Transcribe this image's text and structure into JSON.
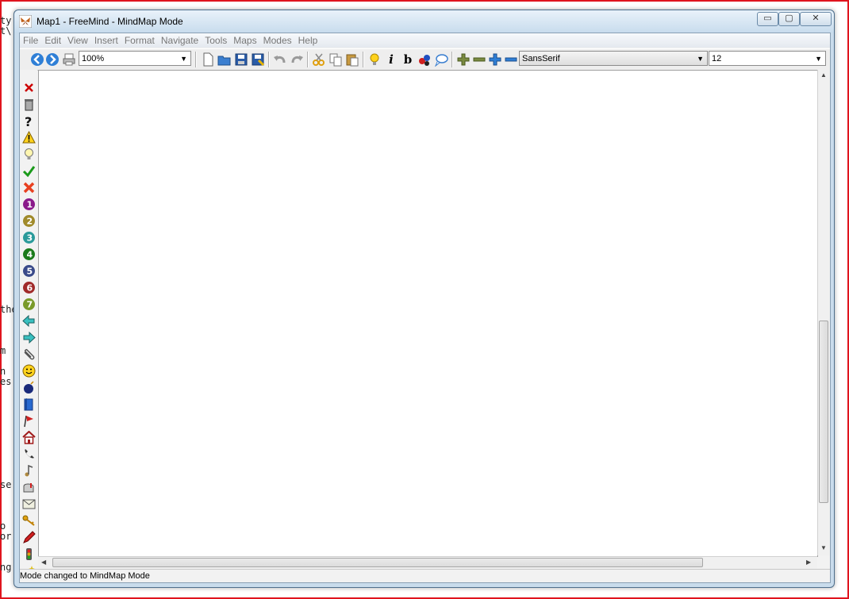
{
  "window": {
    "title": "Map1 - FreeMind - MindMap Mode",
    "minimize_label": "▭",
    "maximize_label": "▢",
    "close_label": "✕"
  },
  "menu": [
    "File",
    "Edit",
    "View",
    "Insert",
    "Format",
    "Navigate",
    "Tools",
    "Maps",
    "Modes",
    "Help"
  ],
  "toolbar": {
    "zoom_value": "100%",
    "font_family": "SansSerif",
    "font_size": "12",
    "bold_label": "b",
    "italic_label": "i"
  },
  "icons_sidebar": [
    "remove-icon",
    "trash-icon",
    "question-icon",
    "warning-icon",
    "idea-icon",
    "check-icon",
    "cross-icon",
    "priority-1-icon",
    "priority-2-icon",
    "priority-3-icon",
    "priority-4-icon",
    "priority-5-icon",
    "priority-6-icon",
    "priority-7-icon",
    "back-arrow-icon",
    "forward-arrow-icon",
    "attachment-icon",
    "smiley-icon",
    "bomb-icon",
    "book-icon",
    "flag-icon",
    "home-icon",
    "phone-icon",
    "music-icon",
    "mailbox-icon",
    "mail-icon",
    "key-icon",
    "pencil-icon",
    "traffic-light-icon",
    "wizard-icon"
  ],
  "priority_labels": [
    "1",
    "2",
    "3",
    "4",
    "5",
    "6",
    "7"
  ],
  "background_fragments": [
    "ty",
    "t\\",
    "the",
    "m",
    "n",
    "es",
    "se",
    "o",
    "or",
    "ng"
  ],
  "status": "Mode changed to MindMap Mode"
}
